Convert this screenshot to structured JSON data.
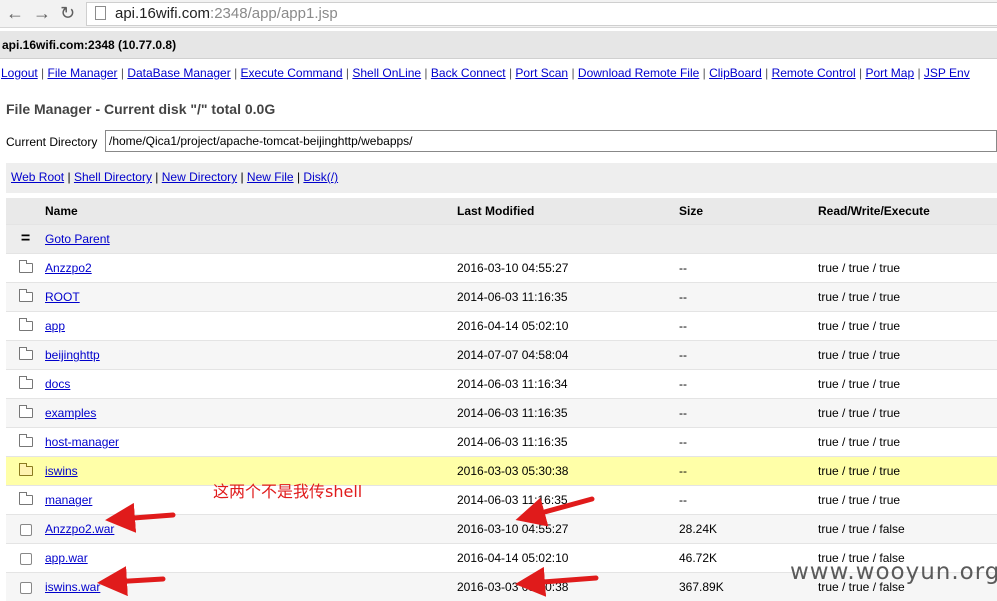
{
  "browser": {
    "back_icon": "back-arrow-icon",
    "forward_icon": "forward-arrow-icon",
    "reload_icon": "reload-icon",
    "url_host": "api.16wifi.com",
    "url_rest": ":2348/app/app1.jsp"
  },
  "host_bar": {
    "text": "api.16wifi.com:2348 (10.77.0.8)"
  },
  "menu": [
    {
      "label": "Logout"
    },
    {
      "label": "File Manager"
    },
    {
      "label": "DataBase Manager"
    },
    {
      "label": "Execute Command"
    },
    {
      "label": "Shell OnLine"
    },
    {
      "label": "Back Connect"
    },
    {
      "label": "Port Scan"
    },
    {
      "label": "Download Remote File"
    },
    {
      "label": "ClipBoard"
    },
    {
      "label": "Remote Control"
    },
    {
      "label": "Port Map"
    },
    {
      "label": "JSP Env"
    }
  ],
  "file_manager": {
    "title": "File Manager - Current disk \"/\" total 0.0G",
    "current_dir_label": "Current Directory",
    "current_dir_value": "/home/Qica1/project/apache-tomcat-beijinghttp/webapps/",
    "shortcuts": [
      {
        "label": "Web Root"
      },
      {
        "label": "Shell Directory"
      },
      {
        "label": "New Directory"
      },
      {
        "label": "New File"
      },
      {
        "label": "Disk(/)"
      }
    ],
    "columns": {
      "name": "Name",
      "modified": "Last Modified",
      "size": "Size",
      "rwx": "Read/Write/Execute"
    },
    "parent": {
      "symbol": "=",
      "label": "Goto Parent"
    },
    "rows": [
      {
        "type": "folder",
        "name": "Anzzpo2",
        "modified": "2016-03-10 04:55:27",
        "size": "--",
        "rwx": "true / true / true"
      },
      {
        "type": "folder",
        "name": "ROOT",
        "modified": "2014-06-03 11:16:35",
        "size": "--",
        "rwx": "true / true / true"
      },
      {
        "type": "folder",
        "name": "app",
        "modified": "2016-04-14 05:02:10",
        "size": "--",
        "rwx": "true / true / true"
      },
      {
        "type": "folder",
        "name": "beijinghttp",
        "modified": "2014-07-07 04:58:04",
        "size": "--",
        "rwx": "true / true / true"
      },
      {
        "type": "folder",
        "name": "docs",
        "modified": "2014-06-03 11:16:34",
        "size": "--",
        "rwx": "true / true / true"
      },
      {
        "type": "folder",
        "name": "examples",
        "modified": "2014-06-03 11:16:35",
        "size": "--",
        "rwx": "true / true / true"
      },
      {
        "type": "folder",
        "name": "host-manager",
        "modified": "2014-06-03 11:16:35",
        "size": "--",
        "rwx": "true / true / true"
      },
      {
        "type": "folder",
        "name": "iswins",
        "modified": "2016-03-03 05:30:38",
        "size": "--",
        "rwx": "true / true / true",
        "highlight": true
      },
      {
        "type": "folder",
        "name": "manager",
        "modified": "2014-06-03 11:16:35",
        "size": "--",
        "rwx": "true / true / true"
      },
      {
        "type": "file",
        "name": "Anzzpo2.war",
        "modified": "2016-03-10 04:55:27",
        "size": "28.24K",
        "rwx": "true / true / false"
      },
      {
        "type": "file",
        "name": "app.war",
        "modified": "2016-04-14 05:02:10",
        "size": "46.72K",
        "rwx": "true / true / false"
      },
      {
        "type": "file",
        "name": "iswins.war",
        "modified": "2016-03-03 05:30:38",
        "size": "367.89K",
        "rwx": "true / true / false"
      }
    ]
  },
  "annotation": {
    "text": "这两个不是我传shell",
    "color": "#e01b1b"
  },
  "watermark": {
    "text": "www.wooyun.org"
  }
}
